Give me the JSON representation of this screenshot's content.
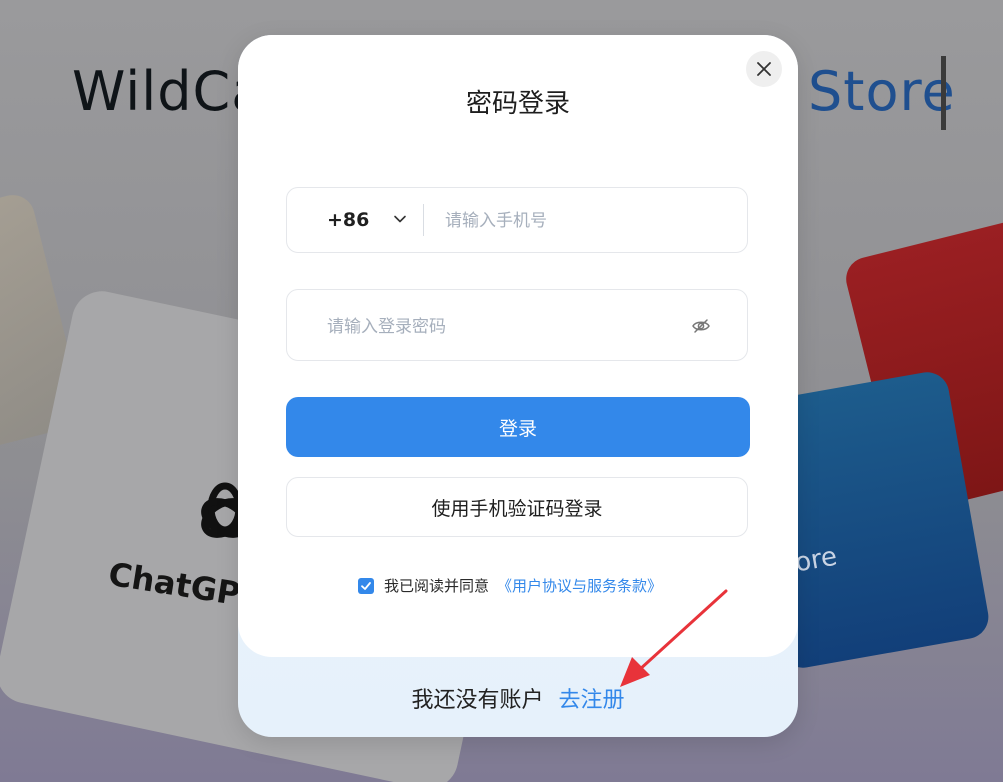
{
  "background": {
    "title_left": "WildCa",
    "title_right": "Store",
    "chatgpt_text": "ChatGP",
    "blue_card_text": "ore"
  },
  "modal": {
    "title": "密码登录",
    "country_code": "+86",
    "phone_placeholder": "请输入手机号",
    "password_placeholder": "请输入登录密码",
    "login_button": "登录",
    "sms_login_button": "使用手机验证码登录",
    "agreement_text": "我已阅读并同意",
    "agreement_link": "《用户协议与服务条款》",
    "agreement_checked": true,
    "footer_text": "我还没有账户",
    "register_link": "去注册"
  },
  "colors": {
    "accent": "#3388ea",
    "annotation_arrow": "#e8333a"
  },
  "icons": {
    "close": "close-icon",
    "chevron": "chevron-down-icon",
    "password_toggle": "eye-off-icon",
    "checkbox": "check-icon"
  }
}
